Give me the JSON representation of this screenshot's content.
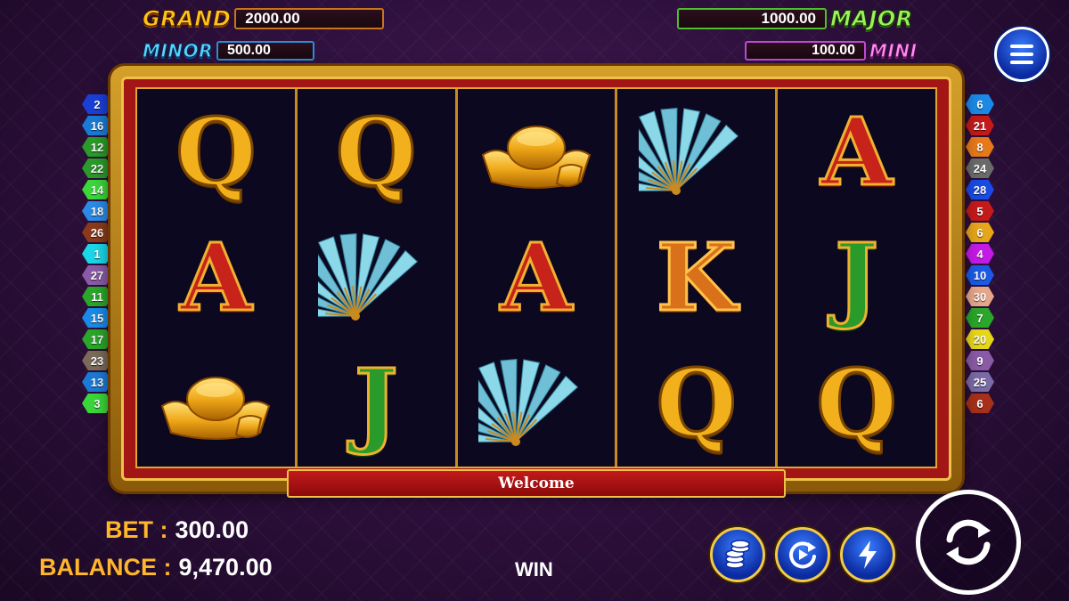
{
  "jackpots": {
    "grand": {
      "label": "GRAND",
      "value": "2000.00"
    },
    "major": {
      "label": "MAJOR",
      "value": "1000.00"
    },
    "minor": {
      "label": "MINOR",
      "value": "500.00"
    },
    "mini": {
      "label": "MINI",
      "value": "100.00"
    }
  },
  "reels": [
    [
      "Q",
      "A",
      "ingot"
    ],
    [
      "Q",
      "fan",
      "J"
    ],
    [
      "ingot",
      "A",
      "fan"
    ],
    [
      "fan",
      "K",
      "Q"
    ],
    [
      "A",
      "J",
      "Q"
    ]
  ],
  "paylines": {
    "left": [
      "2",
      "16",
      "12",
      "22",
      "14",
      "18",
      "26",
      "1",
      "27",
      "11",
      "15",
      "17",
      "23",
      "13",
      "3"
    ],
    "right": [
      "6",
      "21",
      "8",
      "24",
      "28",
      "5",
      "6",
      "4",
      "10",
      "30",
      "7",
      "20",
      "9",
      "25",
      "6"
    ],
    "left_colors": [
      "#1a3fd6",
      "#1a7ad6",
      "#2a9a2a",
      "#2a9a2a",
      "#3ad63a",
      "#2a8ae6",
      "#8a3a1a",
      "#1ad6e6",
      "#8a5aa6",
      "#2aa62a",
      "#1a8ae6",
      "#2aa62a",
      "#7a6a5a",
      "#1a7ad6",
      "#3ad63a"
    ],
    "right_colors": [
      "#1a8ae6",
      "#c41a1a",
      "#e67a1a",
      "#6a6a6a",
      "#1a4ae6",
      "#c41a1a",
      "#e6a61a",
      "#c41ae6",
      "#1a5ae6",
      "#e6a68a",
      "#2aa62a",
      "#e6d61a",
      "#8a5aa6",
      "#7a6aa6",
      "#a6301a"
    ]
  },
  "symbols": {
    "ingot": "gold-ingot-icon",
    "fan": "folding-fan-icon"
  },
  "status": {
    "welcome": "Welcome",
    "win_label": "WIN"
  },
  "bet": {
    "label": "BET :",
    "value": "300.00"
  },
  "balance": {
    "label": "BALANCE :",
    "value": "9,470.00"
  },
  "buttons": {
    "menu": "menu-icon",
    "coins": "coins-icon",
    "autoplay": "autoplay-icon",
    "turbo": "lightning-icon",
    "spin": "spin-icon"
  }
}
